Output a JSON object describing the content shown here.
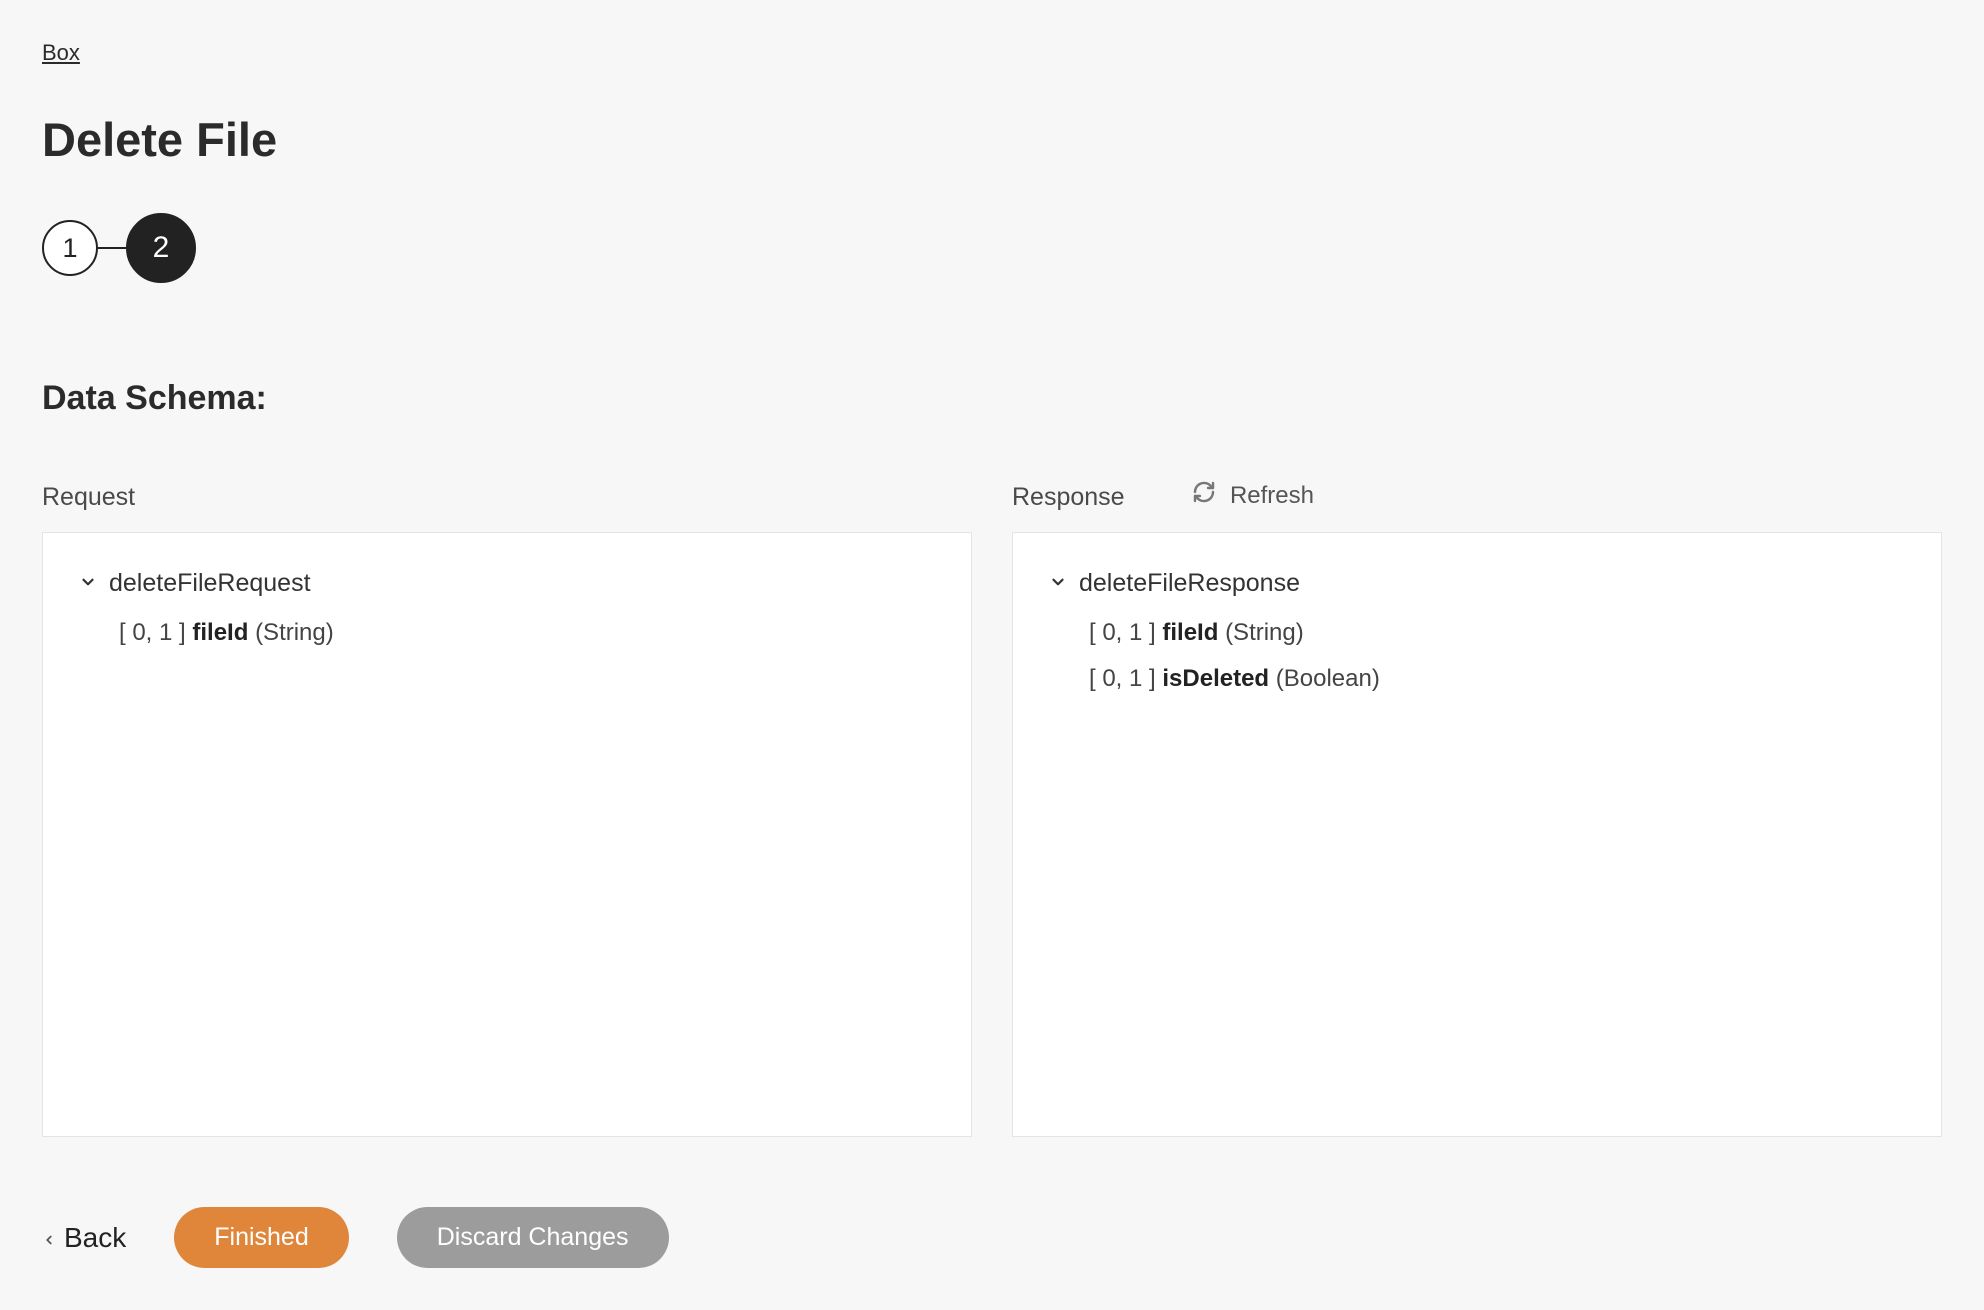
{
  "breadcrumb": "Box",
  "page_title": "Delete File",
  "stepper": {
    "step1": "1",
    "step2": "2",
    "active_index": 2
  },
  "section_title": "Data Schema:",
  "refresh_label": "Refresh",
  "request": {
    "label": "Request",
    "root": "deleteFileRequest",
    "fields": [
      {
        "cardinality": "[ 0, 1 ]",
        "name": "fileId",
        "type": "(String)"
      }
    ]
  },
  "response": {
    "label": "Response",
    "root": "deleteFileResponse",
    "fields": [
      {
        "cardinality": "[ 0, 1 ]",
        "name": "fileId",
        "type": "(String)"
      },
      {
        "cardinality": "[ 0, 1 ]",
        "name": "isDeleted",
        "type": "(Boolean)"
      }
    ]
  },
  "footer": {
    "back": "Back",
    "finished": "Finished",
    "discard": "Discard Changes"
  }
}
